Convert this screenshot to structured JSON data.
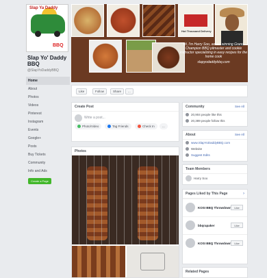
{
  "page": {
    "logo_text": "Slap Ya Daddy",
    "logo_bbq": "BBQ",
    "name": "Slap Yo' Daddy BBQ",
    "handle": "@SlapYoDaddyBBQ"
  },
  "nav": [
    "Home",
    "About",
    "Photos",
    "Videos",
    "Pinterest",
    "Instagram",
    "Events",
    "Google+",
    "Posts",
    "Buy Tickets",
    "Community",
    "Info and Ads"
  ],
  "create_page_label": "Create a Page",
  "cover": {
    "text": "Hi, I'm Harry Soo, award winning Grand Champion BBQ pitmaster and cookie instructor specializing in easy recipes for the home cook",
    "url": "slapyodaddybbq.com",
    "sign_text": "Hot Thousand Delivery"
  },
  "actions": [
    "Like",
    "Follow",
    "Share",
    "..."
  ],
  "create_post": {
    "title": "Create Post",
    "placeholder": "Write a post...",
    "buttons": [
      "Photo/Video",
      "Tag Friends",
      "Check In",
      "..."
    ]
  },
  "photos_title": "Photos",
  "community": {
    "title": "Community",
    "see_all": "See All",
    "likes": "20,904 people like this",
    "follows": "20,389 people follow this"
  },
  "about": {
    "title": "About",
    "see_all": "See All",
    "email": "www.SlapYoDaddyBBQ.com",
    "website": "Website",
    "suggest": "Suggest Edits"
  },
  "team": {
    "title": "Team Members",
    "member": "Harry Soo"
  },
  "liked": {
    "title": "Pages Liked by This Page",
    "items": [
      {
        "name": "KOSI BBQ Throwdown...",
        "btn": "Like"
      },
      {
        "name": "bbqrapaker",
        "btn": "Like"
      },
      {
        "name": "KOSI BBQ Throwdown...",
        "btn": "Like"
      }
    ]
  },
  "related_title": "Related Pages",
  "colors": {
    "accent": "#4267b2",
    "green": "#42b72a",
    "cover_bg": "#6b3a22"
  }
}
